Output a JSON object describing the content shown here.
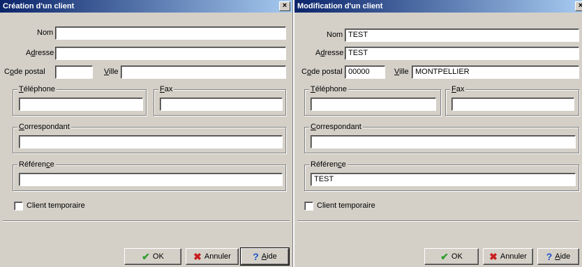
{
  "left": {
    "title": "Création d'un client",
    "labels": {
      "nom": "Nom",
      "adresse_pre": "A",
      "adresse_u": "d",
      "adresse_post": "resse",
      "cp_pre": "C",
      "cp_u": "o",
      "cp_post": "de postal",
      "ville_u": "V",
      "ville_post": "ille",
      "tel_u": "T",
      "tel_post": "éléphone",
      "fax_u": "F",
      "fax_post": "ax",
      "corr_u": "C",
      "corr_post": "orrespondant",
      "ref_pre": "Référen",
      "ref_u": "c",
      "ref_post": "e",
      "temp": "Client temporaire"
    },
    "values": {
      "nom": "",
      "adresse": "",
      "code_postal": "",
      "ville": "",
      "telephone": "",
      "fax": "",
      "correspondant": "",
      "reference": ""
    },
    "buttons": {
      "ok": "OK",
      "annuler": "Annuler",
      "aide_u": "A",
      "aide_post": "ide"
    }
  },
  "right": {
    "title": "Modification d'un client",
    "labels": {
      "nom": "Nom",
      "adresse_pre": "A",
      "adresse_u": "d",
      "adresse_post": "resse",
      "cp_pre": "C",
      "cp_u": "o",
      "cp_post": "de postal",
      "ville_u": "V",
      "ville_post": "ille",
      "tel_u": "T",
      "tel_post": "éléphone",
      "fax_u": "F",
      "fax_post": "ax",
      "corr_u": "C",
      "corr_post": "orrespondant",
      "ref_pre": "Référen",
      "ref_u": "c",
      "ref_post": "e",
      "temp": "Client temporaire"
    },
    "values": {
      "nom": "TEST",
      "adresse": "TEST",
      "code_postal": "00000",
      "ville": "MONTPELLIER",
      "telephone": "",
      "fax": "",
      "correspondant": "",
      "reference": "TEST"
    },
    "buttons": {
      "ok": "OK",
      "annuler": "Annuler",
      "aide_u": "A",
      "aide_post": "ide"
    }
  },
  "icons": {
    "close": "close-icon",
    "ok": "checkmark-icon",
    "cancel": "red-x-icon",
    "help": "question-mark-icon"
  },
  "colors": {
    "title_start": "#0a246a",
    "title_end": "#a6caf0",
    "dialog_bg": "#d4d0c8"
  }
}
